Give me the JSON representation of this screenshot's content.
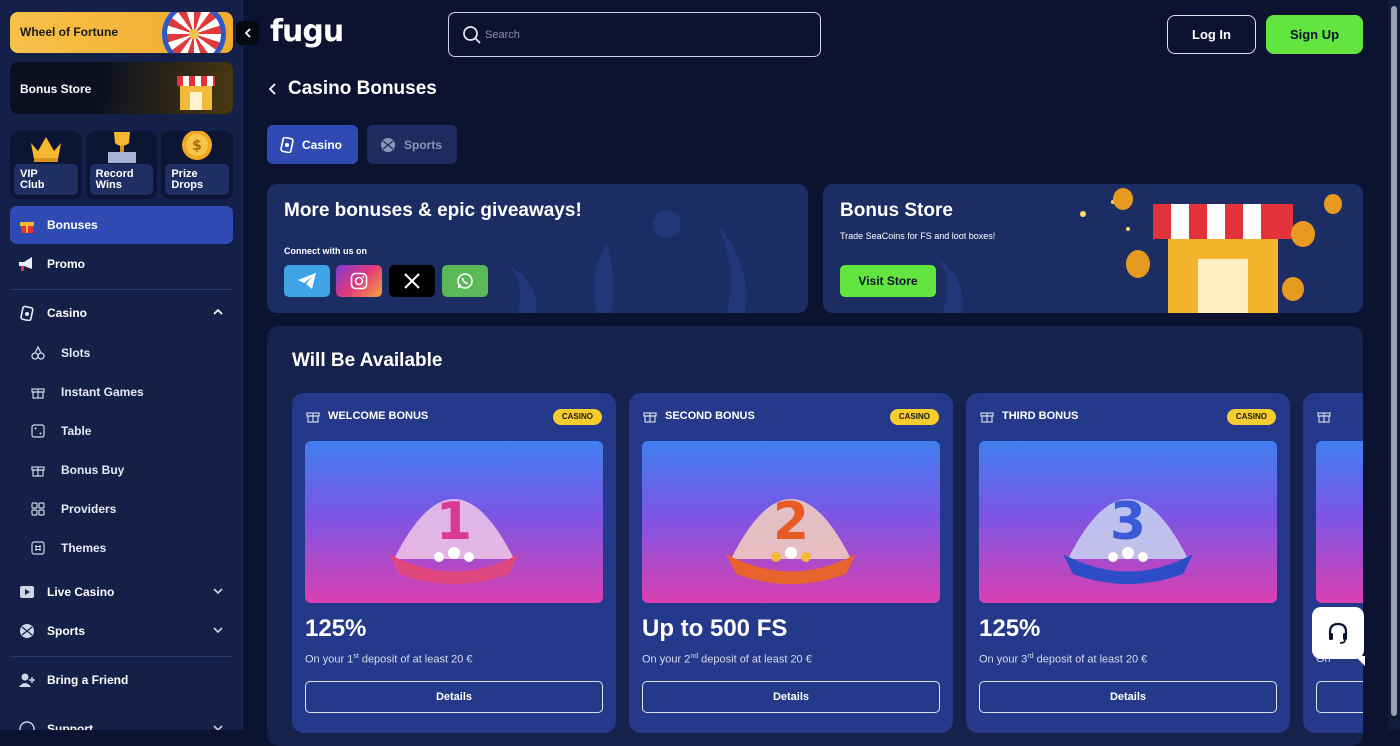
{
  "sidebar": {
    "wheel_of_fortune": "Wheel of Fortune",
    "bonus_store": "Bonus Store",
    "tiles": [
      {
        "line1": "VIP",
        "line2": "Club"
      },
      {
        "line1": "Record",
        "line2": "Wins"
      },
      {
        "line1": "Prize",
        "line2": "Drops"
      }
    ],
    "bonuses": "Bonuses",
    "promo": "Promo",
    "casino": "Casino",
    "casino_sub": [
      "Slots",
      "Instant Games",
      "Table",
      "Bonus Buy",
      "Providers",
      "Themes"
    ],
    "live_casino": "Live Casino",
    "sports": "Sports",
    "bring_friend": "Bring a Friend",
    "support": "Support"
  },
  "header": {
    "logo": "fugu",
    "search_placeholder": "Search",
    "login": "Log In",
    "signup": "Sign Up"
  },
  "page": {
    "title": "Casino Bonuses",
    "tabs": [
      "Casino",
      "Sports"
    ]
  },
  "promo": {
    "title": "More bonuses & epic giveaways!",
    "connect": "Connect with us on",
    "social": [
      "telegram-icon",
      "instagram-icon",
      "x-icon",
      "whatsapp-icon"
    ]
  },
  "store": {
    "title": "Bonus Store",
    "desc": "Trade SeaCoins for FS and loot boxes!",
    "button": "Visit Store"
  },
  "available": {
    "title": "Will Be Available",
    "cards": [
      {
        "name": "WELCOME BONUS",
        "badge": "CASINO",
        "number": "1",
        "amount": "125%",
        "sub_pre": "On your 1",
        "sup": "st",
        "sub_post": " deposit of at least 20 €",
        "details": "Details"
      },
      {
        "name": "SECOND BONUS",
        "badge": "CASINO",
        "number": "2",
        "amount": "Up to 500 FS",
        "sub_pre": "On your 2",
        "sup": "nd",
        "sub_post": " deposit of at least 20 €",
        "details": "Details"
      },
      {
        "name": "THIRD BONUS",
        "badge": "CASINO",
        "number": "3",
        "amount": "125%",
        "sub_pre": "On your 3",
        "sup": "rd",
        "sub_post": " deposit of at least 20 €",
        "details": "Details"
      }
    ],
    "partial_sub": "On"
  },
  "colors": {
    "accent_green": "#63e53f",
    "active_blue": "#2f4bb3",
    "badge_yellow": "#f6cc2e",
    "background": "#0c1330"
  }
}
